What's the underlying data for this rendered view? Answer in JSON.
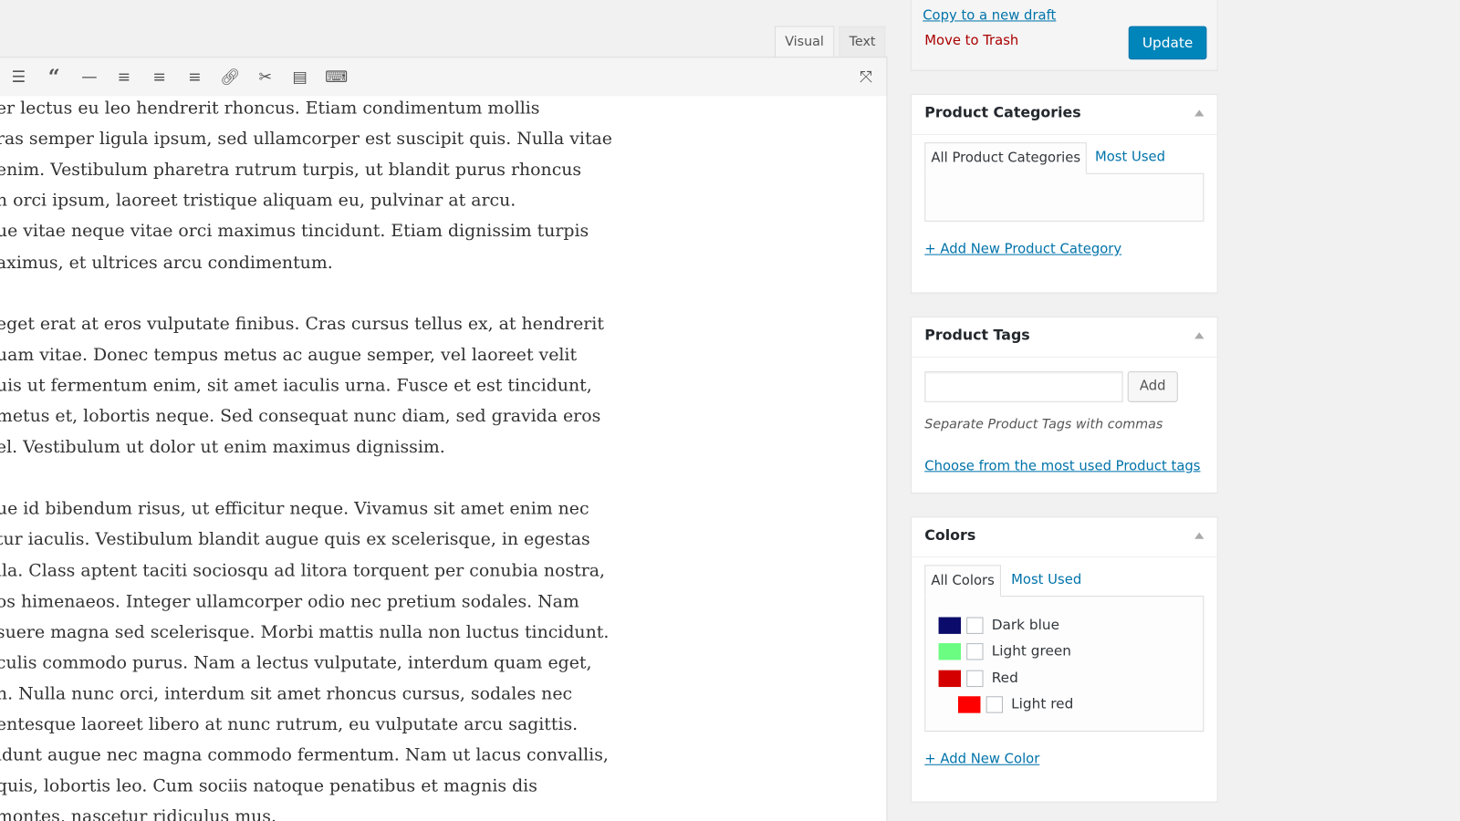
{
  "editor": {
    "tabs": [
      {
        "label": "Visual",
        "active": true
      },
      {
        "label": "Text",
        "active": false
      }
    ],
    "toolbar": [
      "numbered-list-icon",
      "blockquote-icon",
      "horizontal-rule-icon",
      "align-left-icon",
      "align-center-icon",
      "align-right-icon",
      "link-icon",
      "unlink-icon",
      "read-more-icon",
      "toolbar-toggle-icon"
    ],
    "fullscreen_icon": "fullscreen-icon",
    "lines": [
      "er lectus eu leo hendrerit rhoncus. Etiam condimentum mollis",
      "ras semper ligula ipsum, sed ullamcorper est suscipit quis. Nulla vitae",
      " enim. Vestibulum pharetra rutrum turpis, ut blandit purus rhoncus",
      "n orci ipsum, laoreet tristique aliquam eu, pulvinar at arcu.",
      "ue vitae neque vitae orci maximus tincidunt. Etiam dignissim turpis",
      "aximus, et ultrices arcu condimentum.",
      "",
      "eget erat at eros vulputate finibus. Cras cursus tellus ex, at hendrerit",
      "uam vitae. Donec tempus metus ac augue semper, vel laoreet velit",
      "uis ut fermentum enim, sit amet iaculis urna. Fusce et est tincidunt,",
      " metus et, lobortis neque. Sed consequat nunc diam, sed gravida eros",
      "el. Vestibulum ut dolor ut enim maximus dignissim.",
      "",
      "ue id bibendum risus, ut efficitur neque. Vivamus sit amet enim nec",
      "tur iaculis. Vestibulum blandit augue quis ex scelerisque, in egestas",
      "lla. Class aptent taciti sociosqu ad litora torquent per conubia nostra,",
      "os himenaeos. Integer ullamcorper odio nec pretium sodales. Nam",
      "suere magna sed scelerisque. Morbi mattis nulla non luctus tincidunt.",
      "culis commodo purus. Nam a lectus vulputate, interdum quam eget,",
      "h. Nulla nunc orci, interdum sit amet rhoncus cursus, sodales nec",
      "entesque laoreet libero at nunc rutrum, eu vulputate arcu sagittis.",
      "idunt augue nec magna commodo fermentum. Nam ut lacus convallis,",
      " quis, lobortis leo. Cum sociis natoque penatibus et magnis dis",
      "montes, nascetur ridiculus mus."
    ]
  },
  "publish": {
    "copy_draft": "Copy to a new draft",
    "trash": "Move to Trash",
    "update": "Update",
    "accent": "#0085ba",
    "trash_color": "#a00"
  },
  "categories": {
    "title": "Product Categories",
    "tabs": [
      "All Product Categories",
      "Most Used"
    ],
    "add_link": "+ Add New Product Category"
  },
  "tags": {
    "title": "Product Tags",
    "input_value": "",
    "add_button": "Add",
    "hint": "Separate Product Tags with commas",
    "choose_link": "Choose from the most used Product tags"
  },
  "colors": {
    "title": "Colors",
    "tabs": [
      "All Colors",
      "Most Used"
    ],
    "items": [
      {
        "label": "Dark blue",
        "swatch": "#0b0b6b",
        "checked": false,
        "child": false
      },
      {
        "label": "Light green",
        "swatch": "#6bfc82",
        "checked": false,
        "child": false
      },
      {
        "label": "Red",
        "swatch": "#d40000",
        "checked": false,
        "child": false
      },
      {
        "label": "Light red",
        "swatch": "#ff0000",
        "checked": false,
        "child": true
      }
    ],
    "add_link": "+ Add New Color"
  }
}
